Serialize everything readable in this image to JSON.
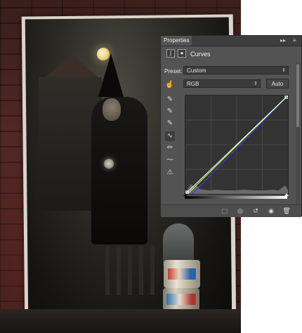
{
  "panel": {
    "tab_label": "Properties",
    "collapse_glyph": "▸▸",
    "menu_glyph": "≡",
    "adjustment_title": "Curves",
    "header_icons": [
      "curves-adjustment-icon",
      "layer-mask-icon"
    ],
    "preset_label": "Preset:",
    "preset_value": "Custom",
    "channel_value": "RGB",
    "auto_label": "Auto",
    "tools": [
      "target-adjustment-hand-icon",
      "sample-black-point-eyedropper-icon",
      "sample-gray-point-eyedropper-icon",
      "sample-white-point-eyedropper-icon",
      "edit-points-curve-icon",
      "draw-pencil-icon",
      "smooth-curve-icon",
      "clipping-warning-icon"
    ],
    "curve": {
      "composite_color": "#ffffff",
      "green_color": "#b6ff3a",
      "blue_color": "#3a3aff",
      "points_in": [
        0,
        255
      ],
      "points_out": [
        0,
        255
      ]
    },
    "footer_icons": [
      "clip-to-layer-icon",
      "view-previous-state-icon",
      "reset-adjustment-icon",
      "toggle-visibility-icon",
      "delete-adjustment-icon"
    ]
  },
  "colors": {
    "panel_bg": "#535353",
    "panel_dark": "#3a3a3a"
  }
}
